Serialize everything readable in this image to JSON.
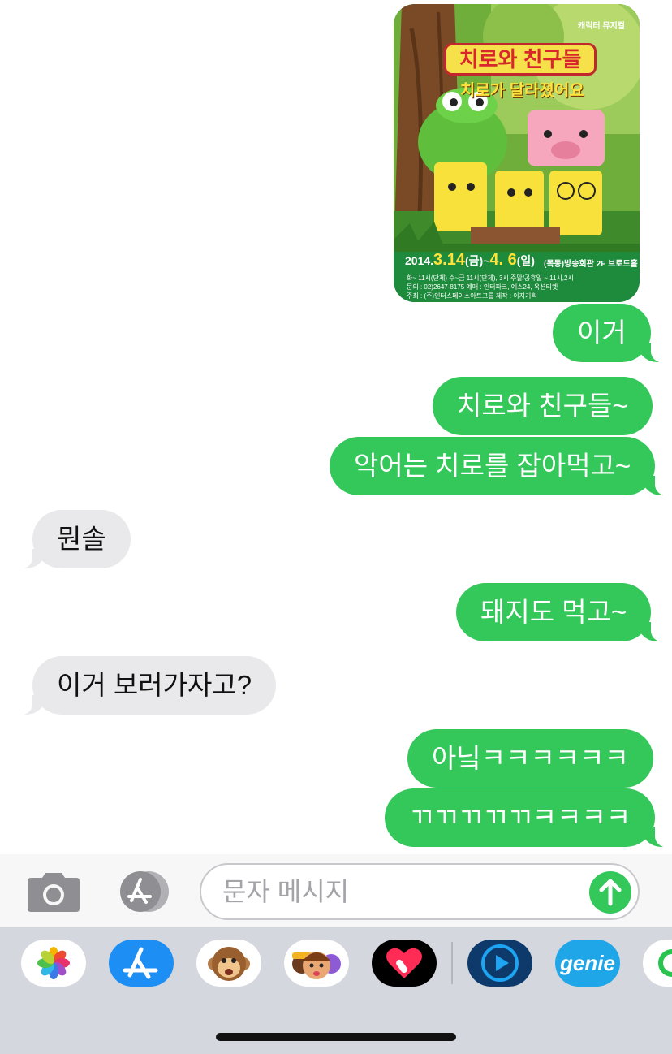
{
  "poster": {
    "category": "캐릭터 뮤지컬",
    "title": "치로와 친구들",
    "subtitle": "치로가 달라졌어요",
    "date_prefix": "2014.",
    "date_start": "3.14",
    "date_start_day": "(금)~",
    "date_end": "4. 6",
    "date_end_day": "(일)",
    "venue": "(목동)방송회관 2F 브로드홀",
    "schedule": "화~ 11시(단체) 수~금 11시(단체), 3시 주말/공휴일 ~ 11시,2시",
    "contact": "문의 : 02)2647-8175  예매 : 인터파크, 예스24, 옥션티켓",
    "organizer": "주최 : (주)인터스페이스아트그룹   제작 : 이지기획"
  },
  "messages": [
    {
      "from": "me",
      "text": "이거"
    },
    {
      "from": "me",
      "text": "치로와 친구들~"
    },
    {
      "from": "me",
      "text": "악어는 치로를 잡아먹고~"
    },
    {
      "from": "them",
      "text": "뭔솔"
    },
    {
      "from": "me",
      "text": "돼지도 먹고~"
    },
    {
      "from": "them",
      "text": "이거 보러가자고?"
    },
    {
      "from": "me",
      "text": "아닠ㅋㅋㅋㅋㅋㅋ"
    },
    {
      "from": "me",
      "text": "ㄲㄲㄲㄲㄲㅋㅋㅋㅋ"
    }
  ],
  "composer": {
    "placeholder": "문자 메시지"
  },
  "drawer": {
    "apps": [
      "photos-icon",
      "app-store-icon",
      "animoji-monkey-icon",
      "memoji-icon",
      "digital-touch-icon",
      "music-player-icon",
      "genie-icon",
      "green-app-icon"
    ],
    "genie_label": "genie"
  },
  "colors": {
    "outgoing": "#34c759",
    "incoming": "#e9e9eb",
    "drawer": "#d4d7dd"
  }
}
